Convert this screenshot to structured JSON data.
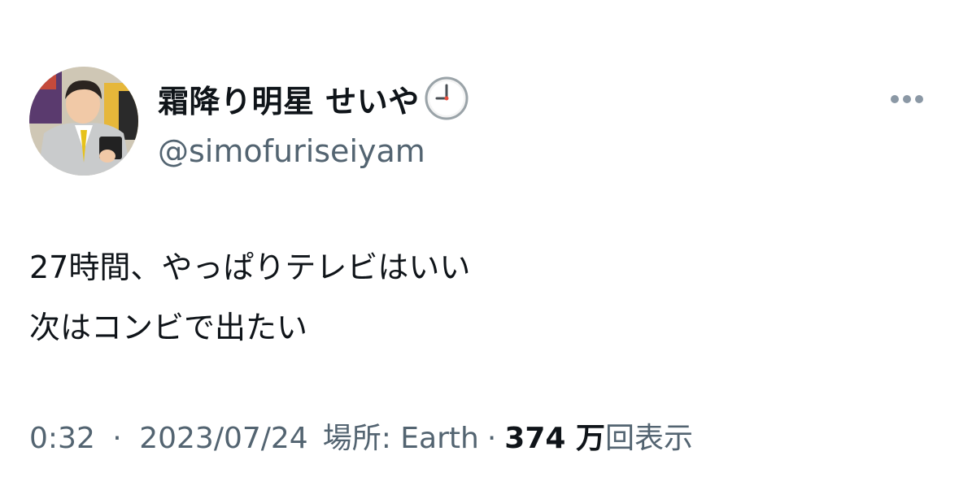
{
  "author": {
    "display_name": "霜降り明星 せいや",
    "handle": "@simofuriseiyam",
    "badge_icon": "clock-nine-icon"
  },
  "tweet": {
    "lines": [
      "27時間、やっぱりテレビはいい",
      "次はコンビで出たい"
    ]
  },
  "meta": {
    "time": "0:32",
    "separator": "·",
    "date": "2023/07/24",
    "location": "場所: Earth",
    "views_count": "374 万",
    "views_label": "回表示"
  },
  "icons": {
    "more": "more-dots-icon"
  },
  "colors": {
    "text_primary": "#0f1419",
    "text_secondary": "#536471",
    "more_dots": "#8b98a5"
  }
}
